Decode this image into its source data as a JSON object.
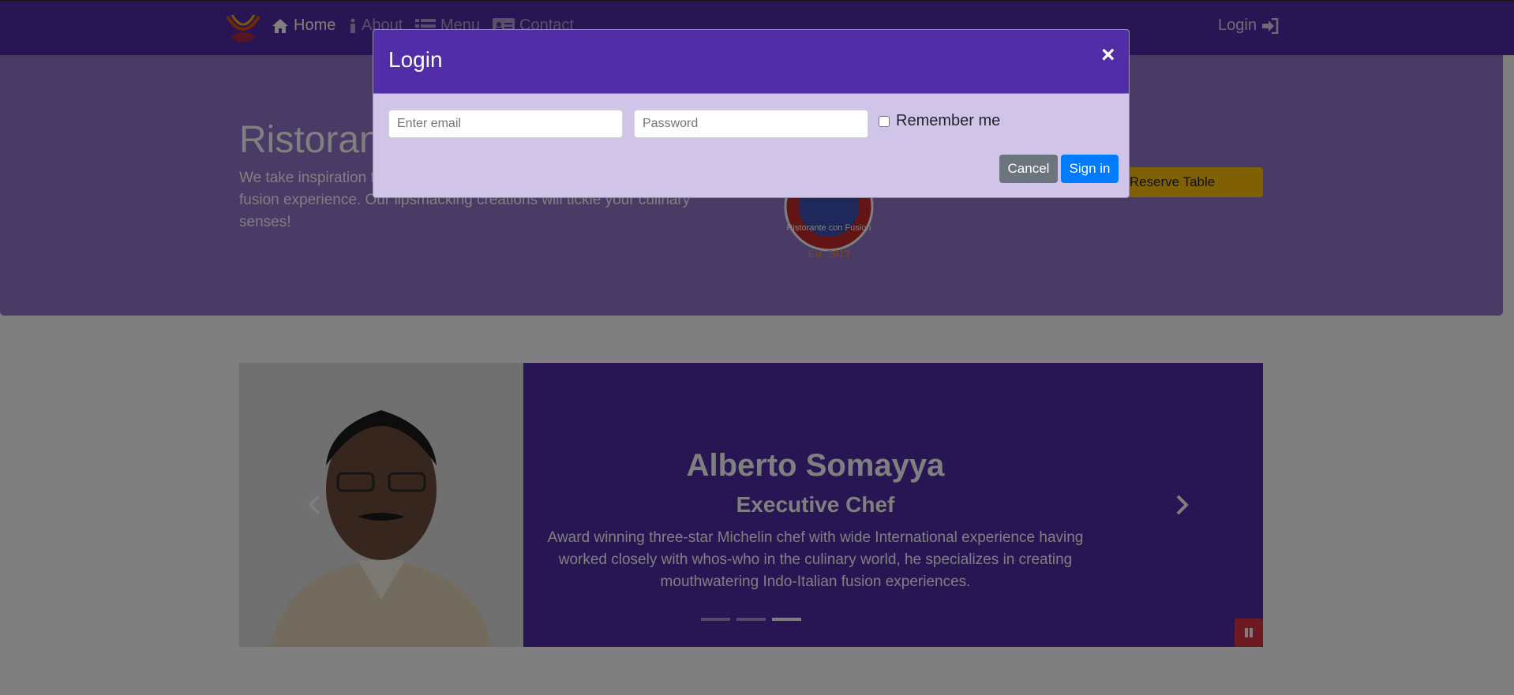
{
  "navbar": {
    "home_label": "Home",
    "about_label": "About",
    "menu_label": "Menu",
    "contact_label": "Contact",
    "login_label": "Login",
    "bg_color": "#512da8"
  },
  "jumbotron": {
    "title": "Ristorante con Fusion",
    "text": "We take inspiration from the World's best cuisines, and create a unique fusion experience. Our lipsmacking creations will tickle your culinary senses!",
    "logo_text": "Ristorante con Fusion",
    "logo_est": "Est. 2013",
    "reserve_label": "Reserve Table",
    "bg_color": "#9575cd"
  },
  "carousel": {
    "name": "Alberto Somayya",
    "role": "Executive Chef",
    "description": "Award winning three-star Michelin chef with wide International experience having worked closely with whos-who in the culinary world, he specializes in creating mouthwatering Indo-Italian fusion experiences.",
    "indicator_count": 3,
    "active_indicator": 3,
    "bg_color": "#512da8"
  },
  "login_modal": {
    "title": "Login",
    "close_symbol": "×",
    "email_placeholder": "Enter email",
    "password_placeholder": "Password",
    "remember_label": "Remember me",
    "cancel_label": "Cancel",
    "signin_label": "Sign in",
    "header_color": "#512da8",
    "body_color": "#d1c4e9"
  },
  "icons": {
    "home": "home-icon",
    "about": "info-icon",
    "menu": "list-icon",
    "contact": "address-card-icon",
    "login": "sign-in-icon",
    "prev": "chevron-left-icon",
    "next": "chevron-right-icon",
    "pause": "pause-icon"
  }
}
